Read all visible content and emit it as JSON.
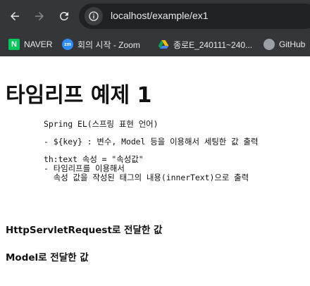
{
  "browser": {
    "url": "localhost/example/ex1",
    "bookmarks": [
      {
        "label": "NAVER",
        "icon": "naver-icon"
      },
      {
        "label": "회의 시작 - Zoom",
        "icon": "zoom-icon"
      },
      {
        "label": "종로E_240111~240...",
        "icon": "google-drive-icon"
      },
      {
        "label": "GitHub",
        "icon": "github-icon"
      }
    ]
  },
  "page": {
    "title": "타임리프 예제 1",
    "pre_text": "Spring EL(스프링 표현 언어)\n\n- ${key} : 변수, Model 등을 이용해서 세팅한 값 출력\n\nth:text 속성 = \"속성값\"\n- 타임리프를 이용해서\n  속성 값을 작성된 태그의 내용(innerText)으로 출력",
    "note1": "HttpServletRequest로 전달한 값",
    "note2": "Model로 전달한 값"
  },
  "colors": {
    "chrome": "#35363a",
    "urlbar": "#202124",
    "text": "#111111"
  }
}
